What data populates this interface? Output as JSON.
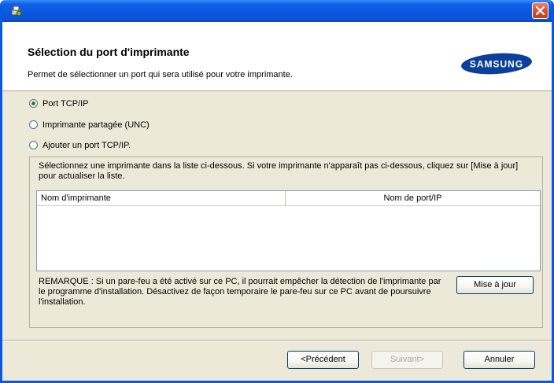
{
  "window": {
    "close_glyph": "✕",
    "accent": "#0a58e0"
  },
  "header": {
    "title": "Sélection du port d'imprimante",
    "subtitle": "Permet de sélectionner un port qui sera utilisé pour votre imprimante.",
    "logo_text": "SAMSUNG",
    "logo_color": "#0a3f9b"
  },
  "port_options": [
    {
      "label": "Port TCP/IP",
      "selected": true
    },
    {
      "label": "Imprimante partagée (UNC)",
      "selected": false
    },
    {
      "label": "Ajouter un port TCP/IP.",
      "selected": false
    }
  ],
  "printer_group": {
    "instruction": "Sélectionnez une imprimante dans la liste ci-dessous. Si votre imprimante n'apparaît pas ci-dessous, cliquez sur [Mise à jour] pour actualiser la liste.",
    "columns": [
      "Nom d'imprimante",
      "Nom de port/IP"
    ],
    "rows": [],
    "note": "REMARQUE : Si un pare-feu a été activé sur ce PC, il pourrait empêcher la détection de l'imprimante par le programme d'installation. Désactivez de façon temporaire le pare-feu sur ce PC avant de poursuivre l'installation.",
    "update_button": "Mise à jour"
  },
  "footer": {
    "back_button": "<Précédent",
    "next_button": "Suivant>",
    "cancel_button": "Annuler"
  }
}
